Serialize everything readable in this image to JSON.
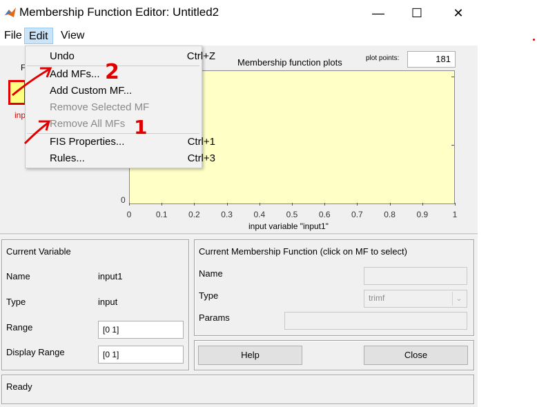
{
  "window": {
    "title": "Membership Function Editor: Untitled2"
  },
  "menubar": {
    "file": "File",
    "edit": "Edit",
    "view": "View"
  },
  "edit_menu": {
    "undo": "Undo",
    "undo_shortcut": "Ctrl+Z",
    "add_mfs": "Add MFs...",
    "add_custom_mf": "Add Custom MF...",
    "remove_selected_mf": "Remove Selected MF",
    "remove_all_mfs": "Remove All MFs",
    "fis_properties": "FIS Properties...",
    "fis_shortcut": "Ctrl+1",
    "rules": "Rules...",
    "rules_shortcut": "Ctrl+3"
  },
  "annotations": {
    "num1": "1",
    "num2": "2"
  },
  "plot": {
    "title": "Membership function plots",
    "plot_points_label": "plot points:",
    "plot_points_value": "181",
    "xlabel": "input variable \"input1\"",
    "xticks": [
      "0",
      "0.1",
      "0.2",
      "0.3",
      "0.4",
      "0.5",
      "0.6",
      "0.7",
      "0.8",
      "0.9",
      "1"
    ],
    "y0": "0",
    "f_label": "F",
    "input_label": "inp"
  },
  "current_variable": {
    "header": "Current Variable",
    "name_label": "Name",
    "name_value": "input1",
    "type_label": "Type",
    "type_value": "input",
    "range_label": "Range",
    "range_value": "[0 1]",
    "display_range_label": "Display Range",
    "display_range_value": "[0 1]"
  },
  "current_mf": {
    "header": "Current Membership Function (click on MF to select)",
    "name_label": "Name",
    "type_label": "Type",
    "type_value": "trimf",
    "params_label": "Params"
  },
  "buttons": {
    "help": "Help",
    "close": "Close"
  },
  "status": "Ready",
  "colors": {
    "plot_bg": "#ffffc6",
    "annotation": "#e00000",
    "menu_highlight": "#cce4f7"
  }
}
